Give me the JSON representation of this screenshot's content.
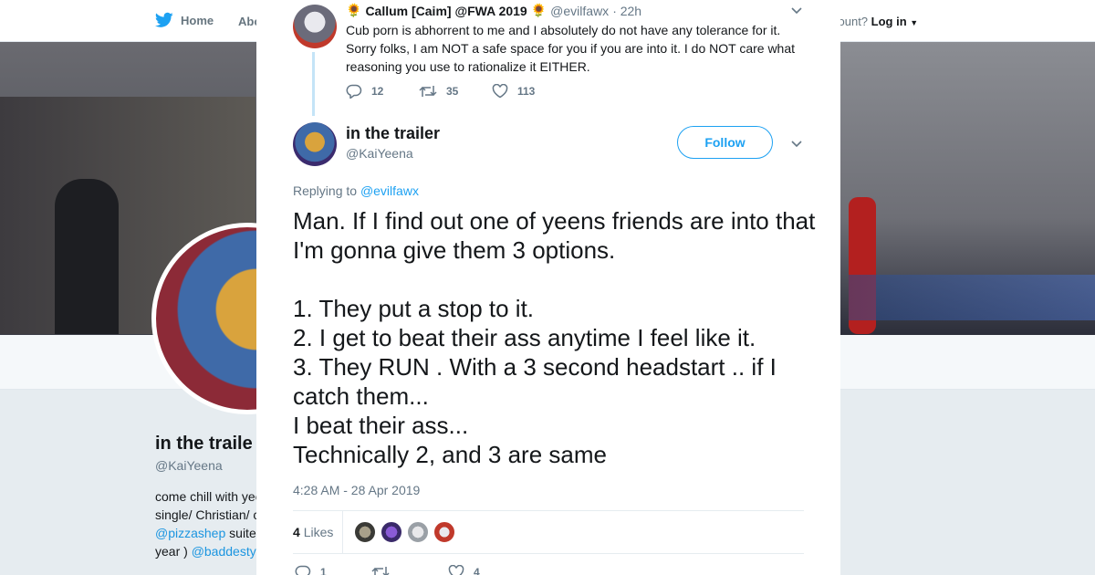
{
  "nav": {
    "home_label": "Home",
    "about_label": "Abo",
    "account_prompt": "count?",
    "login_label": "Log in"
  },
  "profile": {
    "name": "in the traile",
    "handle": "@KaiYeena",
    "bio_lines": [
      "come chill with yee",
      "single/ Christian/ c",
      "suite",
      "year )"
    ],
    "bio_links": [
      "@pizzashep",
      "@baddesty"
    ]
  },
  "parent_tweet": {
    "emoji_left": "🌻",
    "name": "Callum [Caim] @FWA 2019",
    "emoji_right": "🌻",
    "handle": "@evilfawx",
    "time": "· 22h",
    "text": "Cub porn is abhorrent to me and I absolutely do not have any tolerance for it. Sorry folks, I am NOT a safe space for you if you are into it. I do NOT care what reasoning you use to rationalize it EITHER.",
    "replies": "12",
    "retweets": "35",
    "likes": "113"
  },
  "tweet": {
    "name": "in the trailer",
    "handle": "@KaiYeena",
    "follow_label": "Follow",
    "replying_prefix": "Replying to",
    "replying_to": "@evilfawx",
    "text": "Man. If I find out one of yeens friends are into that I'm gonna give them 3 options.\n\n1. They put a stop to it.\n2. I get to beat their ass anytime I feel like it.\n3. They RUN . With a 3 second headstart .. if I catch them...\nI beat their ass...\nTechnically 2, and 3 are same",
    "timestamp": "4:28 AM - 28 Apr 2019",
    "likes_count": "4",
    "likes_label": "Likes",
    "replies": "1",
    "retweets": "",
    "likes": "4"
  },
  "colors": {
    "brand_blue": "#1da1f2",
    "text": "#14171a",
    "muted": "#657786",
    "thread_line": "#c4e4f7"
  },
  "icons": [
    "twitter-bird-icon",
    "chevron-down-icon",
    "close-icon",
    "reply-icon",
    "retweet-icon",
    "heart-icon",
    "sunflower-emoji"
  ]
}
